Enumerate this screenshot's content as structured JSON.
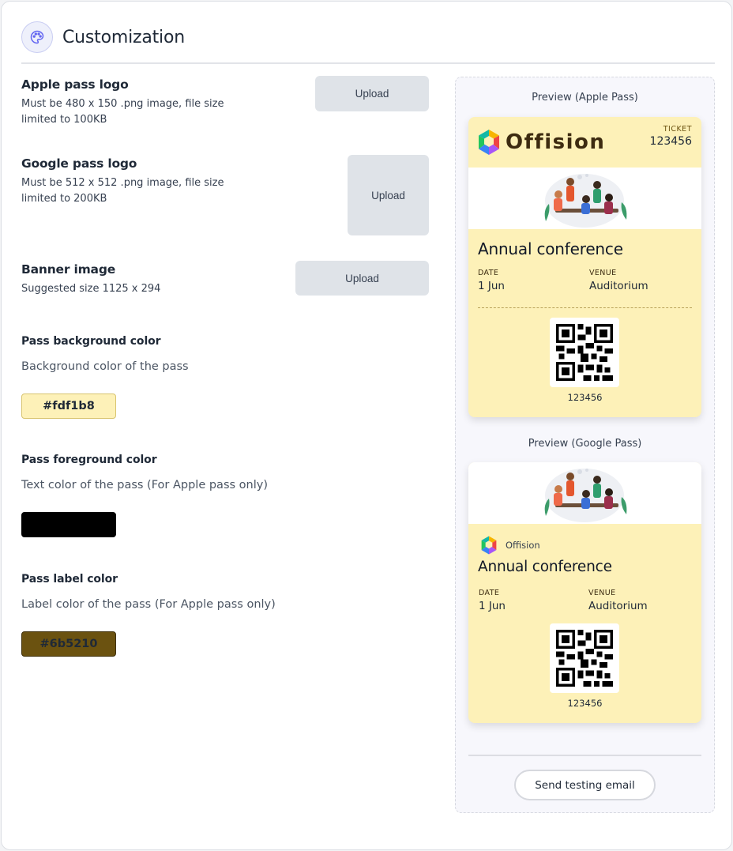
{
  "header": {
    "title": "Customization",
    "icon": "palette-icon"
  },
  "uploads": [
    {
      "title": "Apple pass logo",
      "desc1": "Must be 480 x 150 .png image, file size",
      "desc2": "limited to 100KB",
      "button": "Upload"
    },
    {
      "title": "Google pass logo",
      "desc1": "Must be 512 x 512 .png image, file size",
      "desc2": "limited to 200KB",
      "button": "Upload"
    },
    {
      "title": "Banner image",
      "desc1": "Suggested size 1125 x 294",
      "desc2": "",
      "button": "Upload"
    }
  ],
  "colors": [
    {
      "title": "Pass background color",
      "desc": "Background color of the pass",
      "value": "#fdf1b8",
      "hex": "#fdf1b8"
    },
    {
      "title": "Pass foreground color",
      "desc": "Text color of the pass (For Apple pass only)",
      "value": "",
      "hex": "#000000"
    },
    {
      "title": "Pass label color",
      "desc": "Label color of the pass (For Apple pass only)",
      "value": "#6b5210",
      "hex": "#6b5210"
    }
  ],
  "preview": {
    "apple_label": "Preview (Apple Pass)",
    "google_label": "Preview (Google Pass)",
    "brand": "Offision",
    "ticket_label": "TICKET",
    "ticket_number": "123456",
    "event_title": "Annual conference",
    "date_label": "DATE",
    "date_value": "1 Jun",
    "venue_label": "VENUE",
    "venue_value": "Auditorium",
    "qr_number": "123456"
  },
  "actions": {
    "send_test": "Send testing email"
  }
}
